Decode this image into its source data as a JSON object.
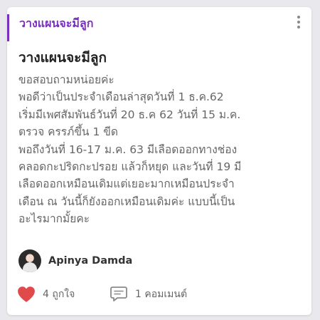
{
  "post": {
    "tag": "วางแผนจะมีลูก",
    "title": "วางแผนจะมีลูก",
    "body_lines": [
      "ขอสอบถามหน่อยค่ะ",
      "พอดีว่าเป็นประจำเดือนล่าสุดวันที่ 1 ธ.ค.62",
      "เริ่มมีเพศสัมพันธ์วันที่ 20 ธ.ค 62 วันที่ 15 ม.ค.",
      "ตรวจ ครรภ์ขึ้น 1 ขีด",
      "พอถึงวันที่ 16-17 ม.ค. 63 มีเลือดออกทางช่อง",
      "คลอดกะปริดกะปรอย แล้วก็หยุด และวันที่ 19 มี",
      "เลือดออกเหมือนเดิมแต่เยอะมากเหมือนประจำ",
      "เดือน ณ วันนี้ก็ยังออกเหมือนเดิมค่ะ แบบนี้เป็น",
      "อะไรมากมั้ยคะ"
    ],
    "author": "Apinya Damda",
    "likes_label": "4 ถูกใจ",
    "comments_label": "1 คอมเมนต์"
  },
  "colors": {
    "accent": "#7b2fbf",
    "heart": "#e04a4a"
  },
  "icons": {
    "more": "more-vertical-icon",
    "like": "heart-icon",
    "comment": "comment-icon"
  }
}
